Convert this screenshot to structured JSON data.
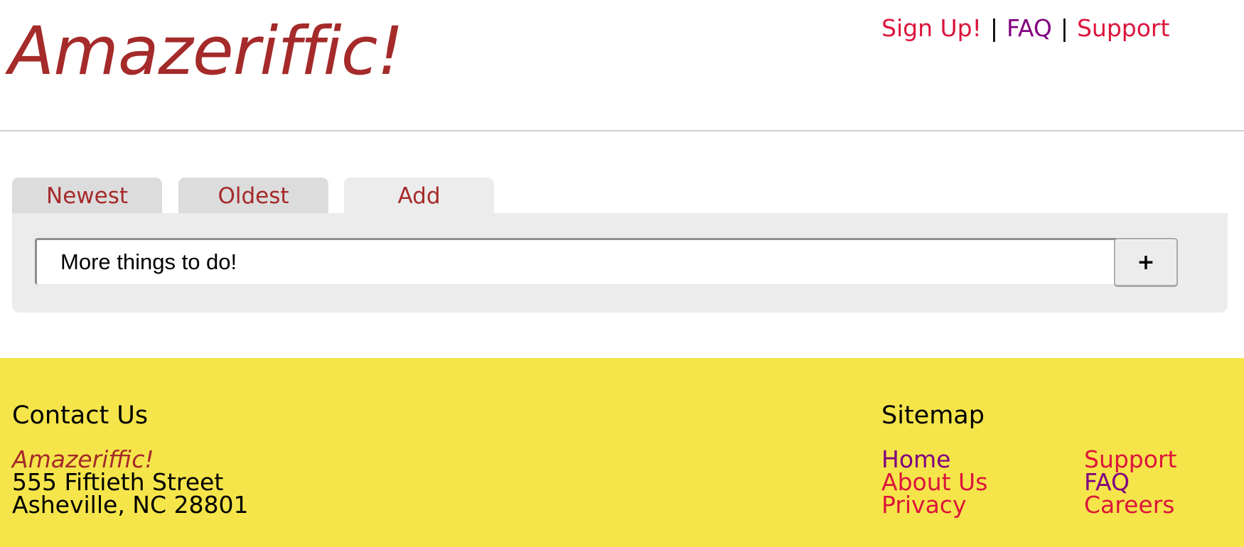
{
  "header": {
    "logo": "Amazeriffic!",
    "nav": [
      {
        "label": "Sign Up!",
        "color": "#dc143c"
      },
      {
        "label": "FAQ",
        "color": "#800080"
      },
      {
        "label": "Support",
        "color": "#dc143c"
      }
    ],
    "separator": "|"
  },
  "tabs": [
    {
      "label": "Newest",
      "active": false
    },
    {
      "label": "Oldest",
      "active": false
    },
    {
      "label": "Add",
      "active": true
    }
  ],
  "add_panel": {
    "input_value": "More things to do!",
    "button_label": "+"
  },
  "footer": {
    "background": "#f5e54a",
    "contact": {
      "heading": "Contact Us",
      "company": "Amazeriffic!",
      "street": "555 Fiftieth Street",
      "city": "Asheville, NC 28801"
    },
    "sitemap": {
      "heading": "Sitemap",
      "col1": [
        {
          "label": "Home",
          "color": "#800080"
        },
        {
          "label": "About Us",
          "color": "#dc143c"
        },
        {
          "label": "Privacy",
          "color": "#dc143c"
        }
      ],
      "col2": [
        {
          "label": "Support",
          "color": "#dc143c"
        },
        {
          "label": "FAQ",
          "color": "#800080"
        },
        {
          "label": "Careers",
          "color": "#dc143c"
        }
      ]
    }
  },
  "colors": {
    "brand": "#a52a2a",
    "link": "#dc143c",
    "visited_link": "#800080"
  }
}
